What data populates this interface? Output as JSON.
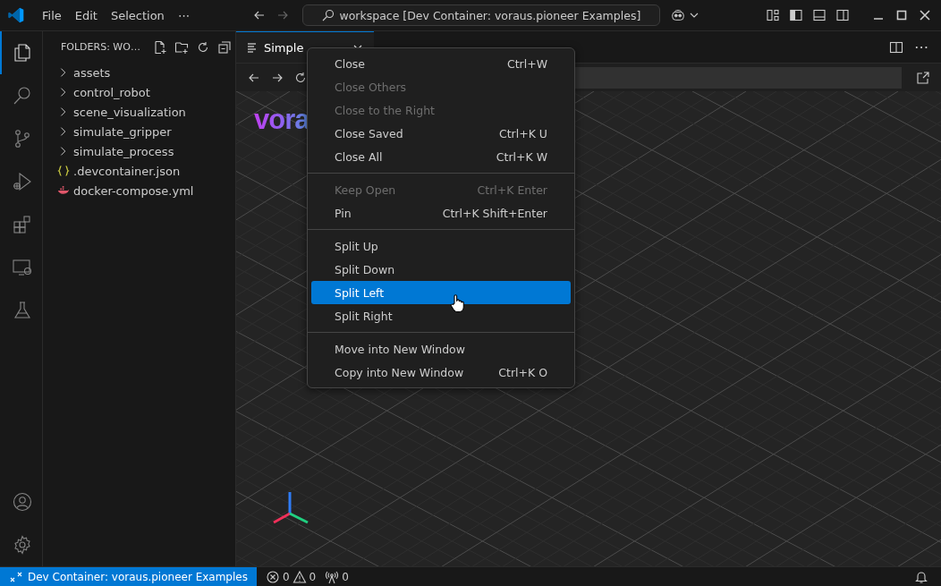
{
  "title_bar": {
    "menus": [
      "File",
      "Edit",
      "Selection",
      "⋯"
    ],
    "command_center": "workspace [Dev Container: voraus.pioneer Examples]"
  },
  "activity_bar": {
    "items": [
      {
        "selected": true
      },
      {
        "selected": false
      },
      {
        "selected": false
      },
      {
        "selected": false
      },
      {
        "selected": false
      },
      {
        "selected": false
      },
      {
        "selected": false
      }
    ]
  },
  "sidebar": {
    "title": "FOLDERS: WO…",
    "items": [
      {
        "label": "assets",
        "kind": "folder"
      },
      {
        "label": "control_robot",
        "kind": "folder"
      },
      {
        "label": "scene_visualization",
        "kind": "folder"
      },
      {
        "label": "simulate_gripper",
        "kind": "folder"
      },
      {
        "label": "simulate_process",
        "kind": "folder"
      },
      {
        "label": ".devcontainer.json",
        "kind": "json"
      },
      {
        "label": "docker-compose.yml",
        "kind": "docker"
      }
    ]
  },
  "editor": {
    "tab": {
      "label": "Simple",
      "selected": true
    },
    "logo_text": "vora"
  },
  "context_menu": {
    "groups": [
      [
        {
          "label": "Close",
          "shortcut": "Ctrl+W",
          "disabled": false,
          "selected": false
        },
        {
          "label": "Close Others",
          "disabled": true,
          "selected": false
        },
        {
          "label": "Close to the Right",
          "disabled": true,
          "selected": false
        },
        {
          "label": "Close Saved",
          "shortcut": "Ctrl+K U",
          "disabled": false,
          "selected": false
        },
        {
          "label": "Close All",
          "shortcut": "Ctrl+K W",
          "disabled": false,
          "selected": false
        }
      ],
      [
        {
          "label": "Keep Open",
          "shortcut": "Ctrl+K Enter",
          "disabled": true,
          "selected": false
        },
        {
          "label": "Pin",
          "shortcut": "Ctrl+K Shift+Enter",
          "disabled": false,
          "selected": false
        }
      ],
      [
        {
          "label": "Split Up",
          "disabled": false,
          "selected": false
        },
        {
          "label": "Split Down",
          "disabled": false,
          "selected": false
        },
        {
          "label": "Split Left",
          "disabled": false,
          "selected": true
        },
        {
          "label": "Split Right",
          "disabled": false,
          "selected": false
        }
      ],
      [
        {
          "label": "Move into New Window",
          "disabled": false,
          "selected": false
        },
        {
          "label": "Copy into New Window",
          "shortcut": "Ctrl+K O",
          "disabled": false,
          "selected": false
        }
      ]
    ]
  },
  "status_bar": {
    "remote": "Dev Container: voraus.pioneer Examples",
    "errors": "0",
    "warnings": "0",
    "ports": "0"
  }
}
